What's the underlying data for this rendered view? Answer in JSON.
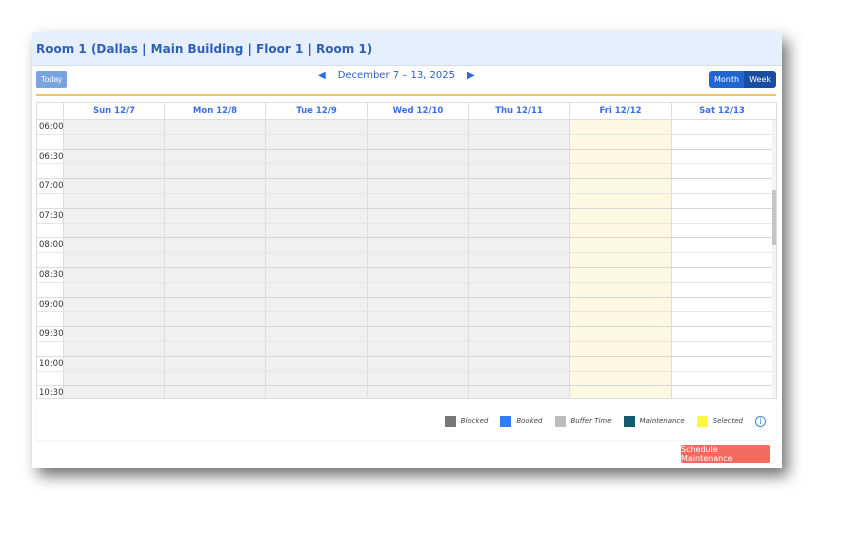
{
  "title": "Room 1 (Dallas | Main Building | Floor 1 | Room 1)",
  "toolbar": {
    "today": "Today",
    "range": "December 7 – 13, 2025",
    "month": "Month",
    "week": "Week"
  },
  "days": [
    {
      "label": "Sun 12/7",
      "state": "blocked"
    },
    {
      "label": "Mon 12/8",
      "state": "blocked"
    },
    {
      "label": "Tue 12/9",
      "state": "blocked"
    },
    {
      "label": "Wed 12/10",
      "state": "blocked"
    },
    {
      "label": "Thu 12/11",
      "state": "blocked"
    },
    {
      "label": "Fri 12/12",
      "state": "today"
    },
    {
      "label": "Sat 12/13",
      "state": "open"
    }
  ],
  "times": [
    "06:00",
    "06:30",
    "07:00",
    "07:30",
    "08:00",
    "08:30",
    "09:00",
    "09:30",
    "10:00",
    "10:30"
  ],
  "legend": [
    {
      "label": "Blocked",
      "color": "#777777"
    },
    {
      "label": "Booked",
      "color": "#2f7df6"
    },
    {
      "label": "Buffer Time",
      "color": "#bdbdbd"
    },
    {
      "label": "Maintenance",
      "color": "#155a73"
    },
    {
      "label": "Selected",
      "color": "#fbf73a"
    }
  ],
  "schedule_button": "Schedule Maintenance"
}
